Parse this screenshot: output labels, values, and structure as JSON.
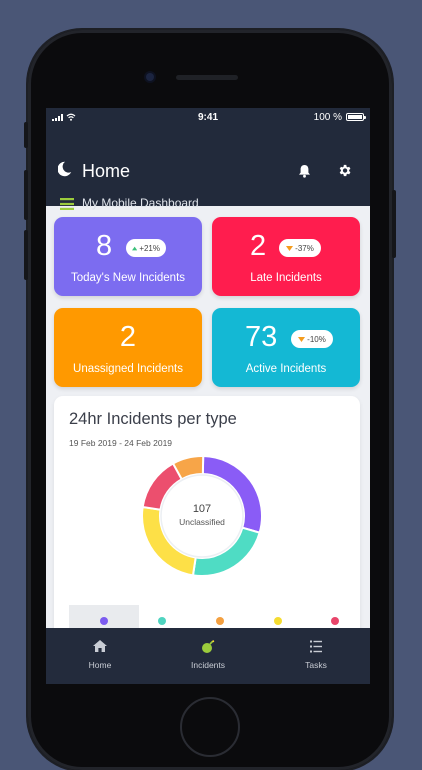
{
  "status_bar": {
    "time": "9:41",
    "battery": "100 %"
  },
  "header": {
    "title": "Home",
    "dashboard_title": "My Mobile Dashboard"
  },
  "tiles": [
    {
      "value": "8",
      "label": "Today's New Incidents",
      "badge": "+21%",
      "trend": "up",
      "color": "#7c6cf0"
    },
    {
      "value": "2",
      "label": "Late Incidents",
      "badge": "-37%",
      "trend": "down",
      "color": "#ff1d4e"
    },
    {
      "value": "2",
      "label": "Unassigned Incidents",
      "color": "#ff9900"
    },
    {
      "value": "73",
      "label": "Active Incidents",
      "badge": "-10%",
      "trend": "down",
      "color": "#14b8d4"
    }
  ],
  "chart_card": {
    "title": "24hr Incidents per type",
    "date_range": "19 Feb 2019 - 24 Feb 2019",
    "center_value": "107",
    "center_label": "Unclassified"
  },
  "chart_data": {
    "type": "pie",
    "categories": [
      "",
      "",
      "",
      "",
      ""
    ],
    "values": [
      0.28,
      0.22,
      0.24,
      0.14,
      0.08
    ],
    "colors": [
      "#8a5cf6",
      "#4fdcc4",
      "#fde047",
      "#ec4f6e",
      "#f7a548"
    ]
  },
  "legend_colors": [
    "#7c5cf0",
    "#4fd4c0",
    "#f4a040",
    "#f5dc30",
    "#e8456a"
  ],
  "tab_bar": {
    "items": [
      {
        "label": "Home",
        "icon": "home-icon"
      },
      {
        "label": "Incidents",
        "icon": "incidents-icon"
      },
      {
        "label": "Tasks",
        "icon": "tasks-icon"
      }
    ]
  },
  "colors": {
    "header_bg": "#222a3b",
    "screen_bg": "#eef0f4",
    "menu_accent": "#9ccc3c",
    "trend_up": "#3bc07a",
    "trend_down": "#f59c1d"
  }
}
